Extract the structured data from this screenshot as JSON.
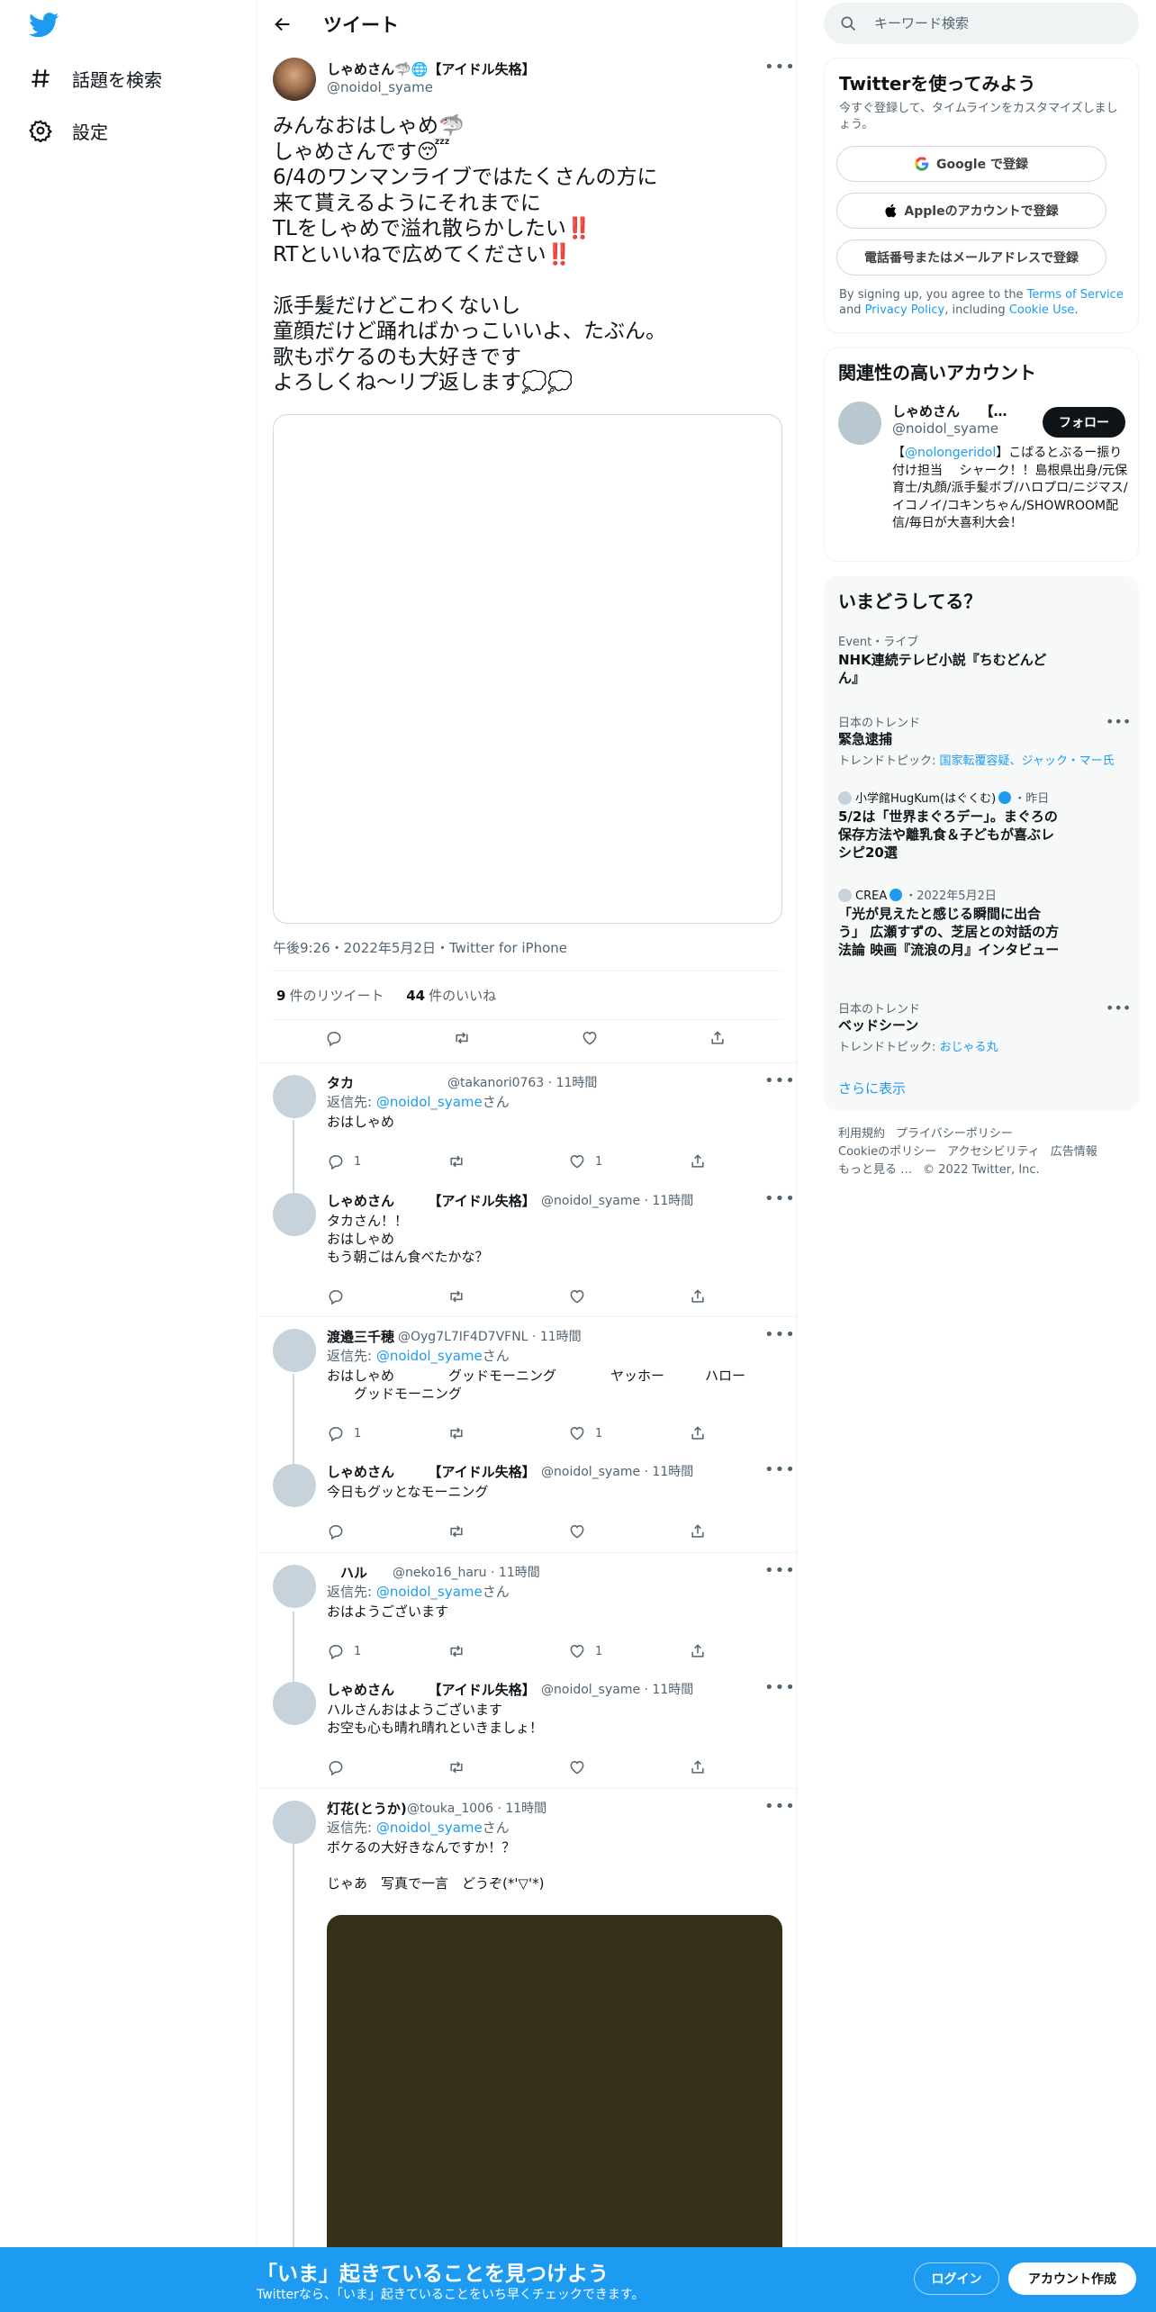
{
  "nav": {
    "explore_label": "話題を検索",
    "settings_label": "設定"
  },
  "header": {
    "title": "ツイート"
  },
  "tweet": {
    "user_name": "しゃめさん🦈🌐【アイドル失格】",
    "user_handle": "@noidol_syame",
    "text": "みんなおはしゃめ🦈\nしゃめさんです😴\n6/4のワンマンライブではたくさんの方に\n来て貰えるようにそれまでに\nTLをしゃめで溢れ散らかしたい‼️\nRTといいねで広めてください‼️\n\n派手髪だけどこわくないし\n童顔だけど踊ればかっこいいよ、たぶん。\n歌もボケるのも大好きです\nよろしくね〜リプ返します💭💭",
    "timestamp": "午後9:26・2022年5月2日・Twitter for iPhone",
    "retweets_count": "9",
    "retweets_label": "件のリツイート",
    "likes_count": "44",
    "likes_label": "件のいいね"
  },
  "replies": [
    {
      "name": "タカ",
      "handle": "@takanori0763 · 11時間",
      "reply_to_prefix": "返信先: ",
      "reply_to_user": "@noidol_syame",
      "reply_to_suffix": "さん",
      "text": "おはしゃめ",
      "replies": "1",
      "likes": "1"
    },
    {
      "name": "しゃめさん　　　【アイドル失格】",
      "handle": "@noidol_syame · 11時間",
      "text": "タカさん！！\nおはしゃめ\nもう朝ごはん食べたかな？"
    },
    {
      "name": "渡邉三千穂",
      "handle": "@Oyg7L7IF4D7VFNL · 11時間",
      "reply_to_prefix": "返信先: ",
      "reply_to_user": "@noidol_syame",
      "reply_to_suffix": "さん",
      "text": "おはしゃめ　　　　グッドモーニング　　　　ヤッホー　　　ハロー\n　　グッドモーニング",
      "replies": "1",
      "likes": "1"
    },
    {
      "name": "しゃめさん　　　【アイドル失格】",
      "handle": "@noidol_syame · 11時間",
      "text": "今日もグッとなモーニング"
    },
    {
      "name": "　ハル",
      "handle": "@neko16_haru · 11時間",
      "reply_to_prefix": "返信先: ",
      "reply_to_user": "@noidol_syame",
      "reply_to_suffix": "さん",
      "text": "おはようございます",
      "replies": "1",
      "likes": "1"
    },
    {
      "name": "しゃめさん　　　【アイドル失格】",
      "handle": "@noidol_syame · 11時間",
      "text": "ハルさんおはようございます\nお空も心も晴れ晴れといきましょ！"
    },
    {
      "name": "灯花(とうか)",
      "handle": "@touka_1006 · 11時間",
      "reply_to_prefix": "返信先: ",
      "reply_to_user": "@noidol_syame",
      "reply_to_suffix": "さん",
      "text": "ボケるの大好きなんですか！？\n\nじゃあ　写真で一言　どうぞ(*'▽'*)"
    }
  ],
  "search": {
    "placeholder": "キーワード検索"
  },
  "signup": {
    "title": "Twitterを使ってみよう",
    "subtitle": "今すぐ登録して、タイムラインをカスタマイズしましょう。",
    "google_label": "Google で登録",
    "apple_label": "Appleのアカウントで登録",
    "phone_label": "電話番号またはメールアドレスで登録",
    "tos_prefix": "By signing up, you agree to the ",
    "tos_terms": "Terms of Service",
    "tos_and": " and ",
    "tos_privacy": "Privacy Policy",
    "tos_including": ", including ",
    "tos_cookie": "Cookie Use",
    "tos_end": "."
  },
  "related": {
    "title": "関連性の高いアカウント",
    "name": "しゃめさん　　【…",
    "handle": "@noidol_syame",
    "follow_label": "フォロー",
    "bio_open": "【",
    "bio_link": "@nolongeridol",
    "bio_rest": "】こばるとぶるー振り付け担当　 シャーク！！島根県出身/元保育士/丸顔/派手髪ボブ/ハロプロ/ニジマス/イコノイ/コキンちゃん/SHOWROOM配信/毎日が大喜利大会！"
  },
  "trends": {
    "title": "いまどうしてる？",
    "items": [
      {
        "category": "Event・ライブ",
        "title": "NHK連続テレビ小説『ちむどんどん』"
      },
      {
        "category": "日本のトレンド",
        "title": "緊急逮捕",
        "topics_label": "トレンドトピック: ",
        "topics": "国家転覆容疑、ジャック・マー氏"
      },
      {
        "category_user": "小学館HugKum(はぐくむ)",
        "category_time": "・昨日",
        "title": "5/2は「世界まぐろデー」。まぐろの保存方法や離乳食＆子どもが喜ぶレシピ20選"
      },
      {
        "category_user": "CREA",
        "category_time": "・2022年5月2日",
        "title": "「光が見えたと感じる瞬間に出合う」 広瀬すずの、芝居との対話の方法論 映画『流浪の月』インタビュー"
      },
      {
        "category": "日本のトレンド",
        "title": "ベッドシーン",
        "topics_label": "トレンドトピック: ",
        "topics": "おじゃる丸"
      }
    ],
    "show_more": "さらに表示"
  },
  "footer": {
    "terms": "利用規約",
    "privacy": "プライバシーポリシー",
    "cookie": "Cookieのポリシー",
    "accessibility": "アクセシビリティ",
    "ads": "広告情報",
    "more": "もっと見る …",
    "copyright": "© 2022 Twitter, Inc."
  },
  "bottom_bar": {
    "title": "「いま」起きていることを見つけよう",
    "subtitle": "Twitterなら、「いま」起きていることをいち早くチェックできます。",
    "login_label": "ログイン",
    "signup_label": "アカウント作成"
  },
  "colors": {
    "accent": "#1d9bf0",
    "text": "#0f1419",
    "muted": "#536471"
  }
}
